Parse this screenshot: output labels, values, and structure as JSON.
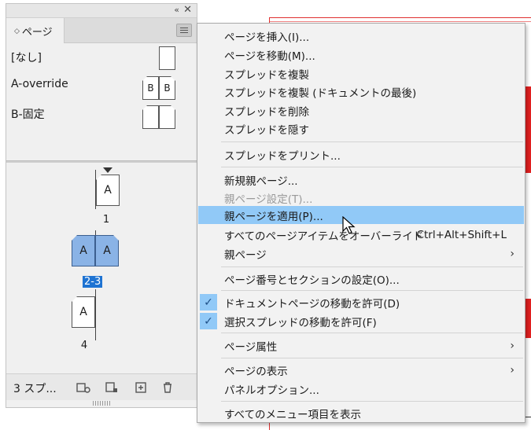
{
  "panel": {
    "tab_label": "ページ",
    "tab_arrows": "◇",
    "collapse_glyph": "«",
    "close_glyph": "✕",
    "parents": [
      {
        "label": "[なし]"
      },
      {
        "label": "A-override",
        "left_letter": "B",
        "right_letter": "B"
      },
      {
        "label": "B-固定"
      }
    ],
    "pages": [
      {
        "letter": "A",
        "number": "1"
      },
      {
        "left_letter": "A",
        "right_letter": "A",
        "number": "2-3"
      },
      {
        "letter": "A",
        "number": "4"
      }
    ],
    "footer_label": "3 スプ..."
  },
  "menu": {
    "items": [
      {
        "label": "ページを挿入(I)..."
      },
      {
        "label": "ページを移動(M)..."
      },
      {
        "label": "スプレッドを複製"
      },
      {
        "label": "スプレッドを複製 (ドキュメントの最後)"
      },
      {
        "label": "スプレッドを削除"
      },
      {
        "label": "スプレッドを隠す"
      },
      {
        "label": "スプレッドをプリント..."
      },
      {
        "label": "新規親ページ..."
      },
      {
        "label": "親ページ設定(T)..."
      },
      {
        "label": "親ページを適用(P)..."
      },
      {
        "label": "すべてのページアイテムをオーバーライド",
        "shortcut": "Ctrl+Alt+Shift+L"
      },
      {
        "label": "親ページ",
        "submenu_glyph": "›"
      },
      {
        "label": "ページ番号とセクションの設定(O)..."
      },
      {
        "label": "ドキュメントページの移動を許可(D)",
        "check_glyph": "✓"
      },
      {
        "label": "選択スプレッドの移動を許可(F)",
        "check_glyph": "✓"
      },
      {
        "label": "ページ属性",
        "submenu_glyph": "›"
      },
      {
        "label": "ページの表示",
        "submenu_glyph": "›"
      },
      {
        "label": "パネルオプション..."
      },
      {
        "label": "すべてのメニュー項目を表示"
      }
    ],
    "highlight_color": "#91c9f7"
  },
  "colors": {
    "selected_page": "#8ab3e6",
    "selected_number_bg": "#1e73d2",
    "document_guide": "#e03030"
  }
}
